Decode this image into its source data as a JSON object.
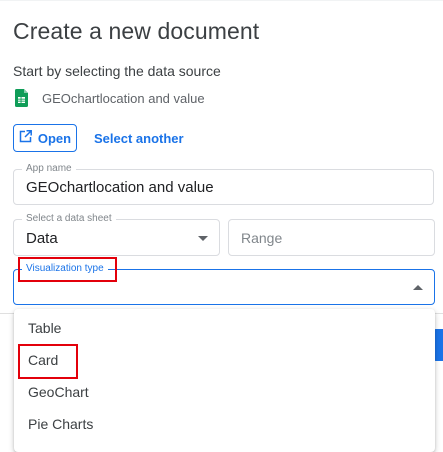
{
  "dialog": {
    "title": "Create a new document",
    "subtitle": "Start by selecting the data source"
  },
  "source": {
    "icon": "google-sheets-icon",
    "name": "GEOchartlocation and value",
    "open_label": "Open",
    "open_icon": "open-in-new-icon",
    "select_another_label": "Select another"
  },
  "form": {
    "app_name": {
      "label": "App name",
      "value": "GEOchartlocation and value"
    },
    "data_sheet": {
      "label": "Select a data sheet",
      "value": "Data"
    },
    "range": {
      "placeholder": "Range"
    },
    "visualization_type": {
      "label": "Visualization type",
      "value": ""
    }
  },
  "dropdown": {
    "options": [
      "Table",
      "Card",
      "GeoChart",
      "Pie Charts"
    ]
  },
  "colors": {
    "accent": "#1a73e8",
    "highlight": "#e3000b",
    "sheets_green": "#0f9d58"
  }
}
